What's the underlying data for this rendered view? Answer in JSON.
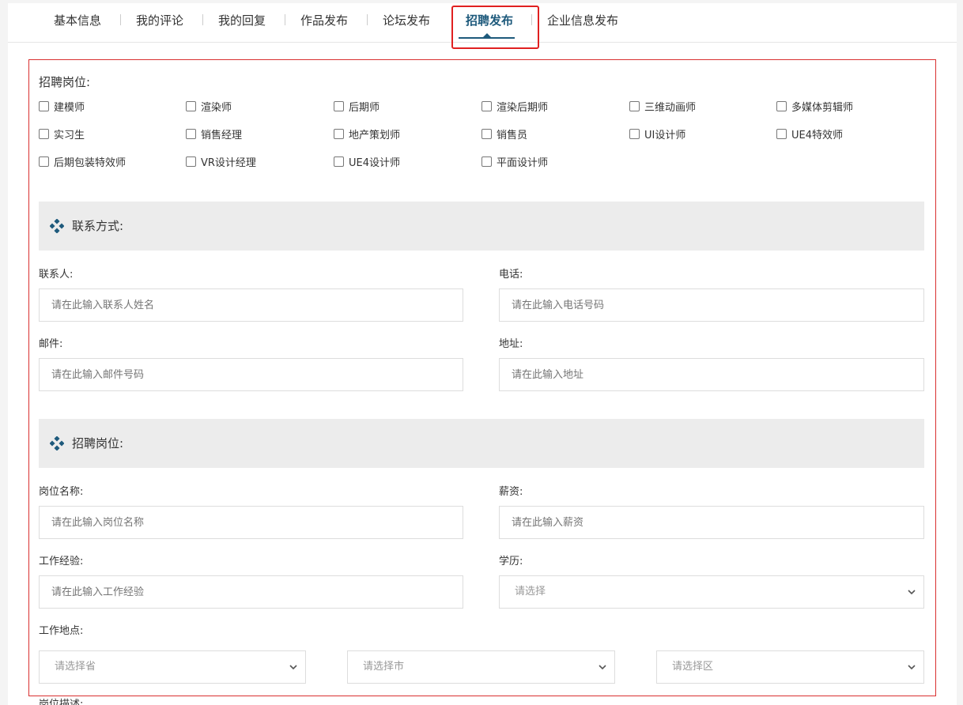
{
  "tabs": [
    "基本信息",
    "我的评论",
    "我的回复",
    "作品发布",
    "论坛发布",
    "招聘发布",
    "企业信息发布"
  ],
  "positions_label": "招聘岗位:",
  "positions": [
    [
      "建模师",
      "渲染师",
      "后期师",
      "渲染后期师",
      "三维动画师",
      "多媒体剪辑师"
    ],
    [
      "实习生",
      "销售经理",
      "地产策划师",
      "销售员",
      "UI设计师",
      "UE4特效师"
    ],
    [
      "后期包装特效师",
      "VR设计经理",
      "UE4设计师",
      "平面设计师"
    ]
  ],
  "contact": {
    "title": "联系方式:",
    "person_label": "联系人:",
    "person_placeholder": "请在此输入联系人姓名",
    "phone_label": "电话:",
    "phone_placeholder": "请在此输入电话号码",
    "email_label": "邮件:",
    "email_placeholder": "请在此输入邮件号码",
    "address_label": "地址:",
    "address_placeholder": "请在此输入地址"
  },
  "job": {
    "title": "招聘岗位:",
    "name_label": "岗位名称:",
    "name_placeholder": "请在此输入岗位名称",
    "salary_label": "薪资:",
    "salary_placeholder": "请在此输入薪资",
    "exp_label": "工作经验:",
    "exp_placeholder": "请在此输入工作经验",
    "edu_label": "学历:",
    "edu_select": "请选择",
    "location_label": "工作地点:",
    "province_select": "请选择省",
    "city_select": "请选择市",
    "district_select": "请选择区",
    "desc_label": "岗位描述:"
  },
  "colors": {
    "accent": "#1e5a7c",
    "highlight": "#e02020",
    "frame": "#d93030",
    "section_bg": "#ececec"
  }
}
